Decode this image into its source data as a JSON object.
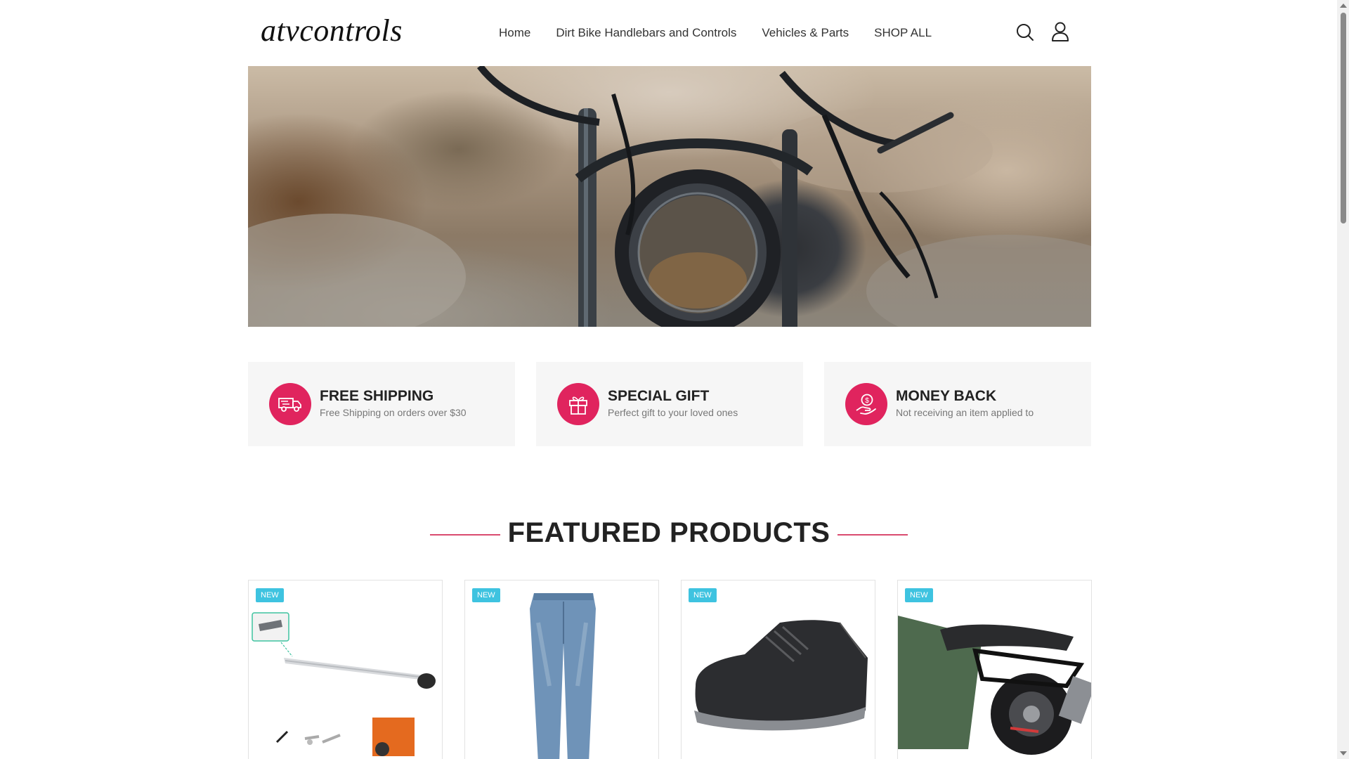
{
  "header": {
    "logo": "atvcontrols",
    "nav": [
      "Home",
      "Dirt Bike Handlebars and Controls",
      "Vehicles & Parts",
      "SHOP ALL"
    ],
    "icons": [
      "search-icon",
      "user-icon"
    ]
  },
  "features": [
    {
      "title": "FREE SHIPPING",
      "subtitle": "Free Shipping on orders over $30",
      "icon": "truck-icon"
    },
    {
      "title": "SPECIAL GIFT",
      "subtitle": "Perfect gift to your loved ones",
      "icon": "gift-icon"
    },
    {
      "title": "MONEY BACK",
      "subtitle": "Not receiving an item applied to",
      "icon": "money-hand-icon"
    }
  ],
  "featured": {
    "title": "FEATURED PRODUCTS",
    "products": [
      {
        "badge": "NEW",
        "image": "kickstand-lever"
      },
      {
        "badge": "NEW",
        "image": "denim-jeans"
      },
      {
        "badge": "NEW",
        "image": "riding-shoe"
      },
      {
        "badge": "NEW",
        "image": "motorcycle-rear-rack"
      }
    ]
  },
  "colors": {
    "accent": "#e0245e",
    "badge": "#3ec3e0",
    "divider": "#d94b6f",
    "feature_bg": "#f6f6f6"
  }
}
